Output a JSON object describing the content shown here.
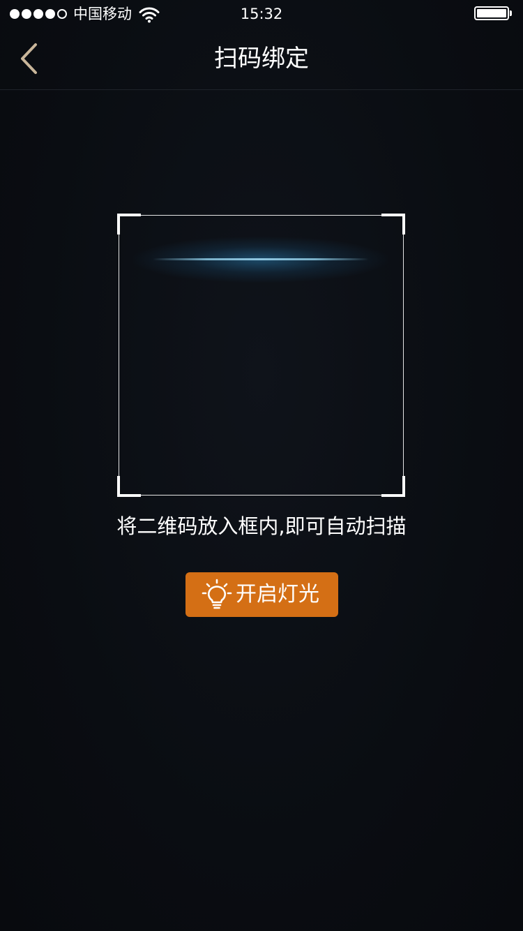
{
  "status_bar": {
    "carrier": "中国移动",
    "time": "15:32",
    "signal_strength": "4 of 5",
    "wifi_icon": "wifi-icon",
    "battery_icon": "battery-icon",
    "battery_level": 1.0
  },
  "nav": {
    "title": "扫码绑定",
    "back_icon": "chevron-left-icon",
    "back_color": "#c9b69a"
  },
  "scanner": {
    "hint": "将二维码放入框内,即可自动扫描"
  },
  "light_button": {
    "label": "开启灯光",
    "icon": "lightbulb-icon",
    "color": "#d46f15"
  }
}
